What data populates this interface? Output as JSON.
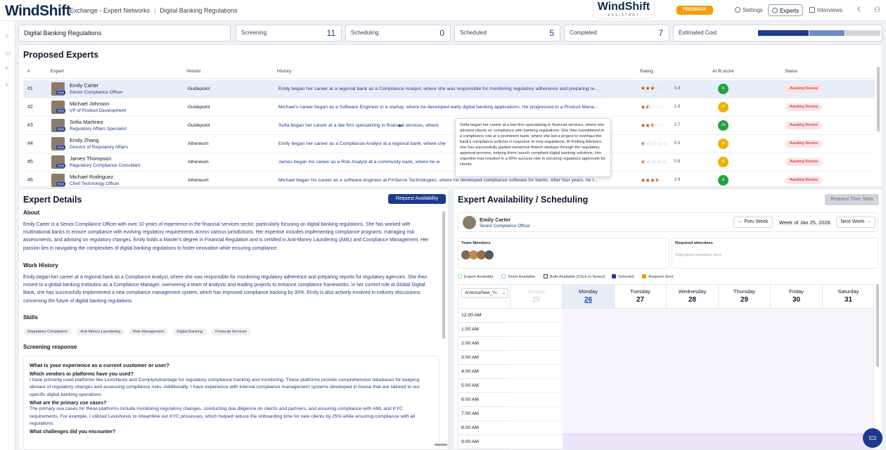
{
  "header": {
    "logo": "WindShift",
    "crumb1": "Exchange - Expert Networks",
    "crumb_sep": "|",
    "crumb2": "Digital Banking Regulations",
    "center_logo": "WindShift",
    "center_sub": "ASSISTANT",
    "feedback": "FEEDBACK",
    "settings": "Settings",
    "experts": "Experts",
    "interviews": "Interviews"
  },
  "stats": {
    "project": "Digital Banking Regulations",
    "screening_label": "Screening",
    "screening": "11",
    "scheduling_label": "Scheduling",
    "scheduling": "0",
    "scheduled_label": "Scheduled",
    "scheduled": "5",
    "completed_label": "Completed",
    "completed": "7",
    "cost_label": "Estimated Cost"
  },
  "experts": {
    "title": "Proposed Experts",
    "columns": [
      "#",
      "Expert",
      "Vendor",
      "History",
      "Rating",
      "AI fit score",
      "Status"
    ],
    "rows": [
      {
        "n": "#1",
        "name": "Emily Carter",
        "title": "Senior Compliance Officer",
        "vendor": "Guidepoint",
        "history": "Emily began her career at a regional bank as a Compliance Analyst, where she was responsible for monitoring regulatory adherence and preparing re...",
        "rating": "3.4",
        "full": 3,
        "half": 0,
        "ai": "9",
        "ai_color": "#22a343",
        "status": "Awaiting Review"
      },
      {
        "n": "#2",
        "name": "Michael Johnson",
        "title": "VP of Product Development",
        "vendor": "Guidepoint",
        "history": "Michael's career began as a Software Engineer in a startup, where he developed early digital banking applications. He progressed to a Product Mana...",
        "rating": "1.6",
        "full": 1,
        "half": 1,
        "ai": "8",
        "ai_color": "#eab308",
        "status": "Awaiting Review"
      },
      {
        "n": "#3",
        "name": "Sofia Martinez",
        "title": "Regulatory Affairs Specialist",
        "vendor": "Guidepoint",
        "history": "Sofia began her career at a law firm specializing in financial services, where",
        "rating": "2.7",
        "full": 2,
        "half": 1,
        "ai": "10",
        "ai_color": "#22a343",
        "status": "Awaiting Review"
      },
      {
        "n": "#4",
        "name": "Emily Zhang",
        "title": "Director of Regulatory Affairs",
        "vendor": "Atheneum",
        "history": "Emily began her career as a Compliance Analyst at a regional bank, where she",
        "rating": "0.5",
        "full": 0,
        "half": 1,
        "ai": "8",
        "ai_color": "#eab308",
        "status": "Awaiting Review"
      },
      {
        "n": "#5",
        "name": "James Thompson",
        "title": "Regulatory Compliance Consultant",
        "vendor": "Atheneum",
        "history": "James began his career as a Risk Analyst at a community bank, where he w",
        "rating": "0.8",
        "full": 0,
        "half": 1,
        "ai": "8",
        "ai_color": "#eab308",
        "status": "Awaiting Review"
      },
      {
        "n": "#6",
        "name": "Michael Rodriguez",
        "title": "Chief Technology Officer",
        "vendor": "Atheneum",
        "history": "Michael began his career as a software engineer at FinServe Technologies, where he developed compliance software for banks. After four years, he t...",
        "rating": "3.9",
        "full": 3,
        "half": 1,
        "ai": "8",
        "ai_color": "#22a343",
        "status": "Awaiting Review"
      }
    ],
    "tooltip": "Sofia began her career at a law firm specializing in financial services, where she advised clients on compliance with banking regulations. She then transitioned to a compliance role at a prominent bank, where she led a project to overhaul the bank's compliance policies in response to new regulations. At FinReg Advisors, she has successfully guided numerous fintech startups through the regulatory approval process, helping them launch compliant digital banking solutions. Her expertise has resulted in a 90% success rate in securing regulatory approvals for clients."
  },
  "details": {
    "title": "Expert Details",
    "request_btn": "Request Availability",
    "about_h": "About",
    "about": "Emily Carter is a Senior Compliance Officer with over 10 years of experience in the financial services sector, particularly focusing on digital banking regulations. She has worked with multinational banks to ensure compliance with evolving regulatory requirements across various jurisdictions. Her expertise includes implementing compliance programs, managing risk assessments, and advising on regulatory changes. Emily holds a Master's degree in Financial Regulation and is certified in Anti-Money Laundering (AML) and Compliance Management. Her passion lies in navigating the complexities of digital banking regulations to foster innovation while ensuring compliance.",
    "work_h": "Work History",
    "work": "Emily began her career at a regional bank as a Compliance Analyst, where she was responsible for monitoring regulatory adherence and preparing reports for regulatory agencies. She then moved to a global banking institution as a Compliance Manager, overseeing a team of analysts and leading projects to enhance compliance frameworks. In her current role at Global Digital Bank, she has successfully implemented a new compliance management system, which has improved compliance tracking by 30%. Emily is also actively involved in industry discussions concerning the future of digital banking regulations.",
    "skills_h": "Skills",
    "skills": [
      "Regulatory Compliance",
      "Anti-Money Laundering",
      "Risk Management",
      "Digital Banking",
      "Financial Services"
    ],
    "screen_h": "Screening response",
    "q1": "What is your experience as a current customer or user?",
    "sq1": "Which vendors or platforms have you used?",
    "a1": "I have primarily used platforms like LexisNexis and ComplyAdvantage for regulatory compliance tracking and monitoring. These platforms provide comprehensive databases for keeping abreast of regulatory changes and assessing compliance risks. Additionally, I have experience with internal compliance management systems developed in-house that are tailored to our specific digital banking operations.",
    "sq2": "What are the primary use cases?",
    "a2": "The primary use cases for these platforms include monitoring regulatory changes, conducting due diligence on clients and partners, and ensuring compliance with AML and KYC requirements. For example, I utilized LexisNexis to streamline our KYC processes, which helped reduce the onboarding time for new clients by 25% while ensuring compliance with all regulations.",
    "sq3": "What challenges did you encounter?"
  },
  "schedule": {
    "title": "Expert Availability / Scheduling",
    "request_btn": "Request Time Slots",
    "expert_name": "Emily Carter",
    "expert_title": "Senior Compliance Officer",
    "prev": "← Prev Week",
    "week": "Week of Jan 25, 2026",
    "next": "Next Week →",
    "team_h": "Team Members",
    "att_h": "Required attendees",
    "att_ph": "Drag team members here",
    "legend": [
      "Expert Available",
      "Team Available",
      "Both Available (Click to Select)",
      "Selected",
      "Request Sent"
    ],
    "tz": "America/New_Yc",
    "days": [
      {
        "n": "Sunday",
        "d": "25"
      },
      {
        "n": "Monday",
        "d": "26"
      },
      {
        "n": "Tuesday",
        "d": "27"
      },
      {
        "n": "Wednesday",
        "d": "28"
      },
      {
        "n": "Thursday",
        "d": "29"
      },
      {
        "n": "Friday",
        "d": "30"
      },
      {
        "n": "Saturday",
        "d": "31"
      }
    ],
    "times": [
      "12:00 AM",
      "1:00 AM",
      "2:00 AM",
      "3:00 AM",
      "4:00 AM",
      "5:00 AM",
      "6:00 AM",
      "7:00 AM",
      "8:00 AM",
      "9:00 AM"
    ]
  }
}
